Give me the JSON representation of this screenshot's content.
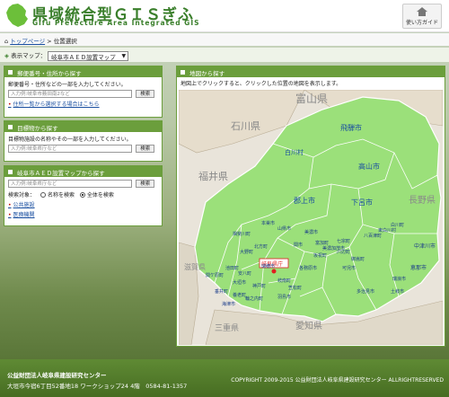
{
  "header": {
    "title": "県域統合型ＧＩＳぎふ",
    "subtitle": "Gifu Prefecture Area Integrated GIS",
    "guide_label": "使い方ガイド"
  },
  "breadcrumb": {
    "home": "トップページ",
    "separator": ">",
    "current": "位置選択"
  },
  "display_map": {
    "label": "表示マップ：",
    "selected": "岐阜市ＡＥＤ設置マップ"
  },
  "postal_panel": {
    "title": "郵便番号・住所から探す",
    "instruction": "郵便番号・住所などの一部を入力してください。",
    "placeholder": "入力例:岐阜市薮田南2など",
    "search_label": "検索",
    "link_label": "住所一覧から選択する場合はこちら"
  },
  "landmark_panel": {
    "title": "目標物から探す",
    "instruction": "目標物施設の名称やその一部を入力してください。",
    "placeholder": "入力例:岐阜県庁など",
    "search_label": "検索"
  },
  "aed_panel": {
    "title": "岐阜市ＡＥＤ設置マップから探す",
    "placeholder": "入力例:岐阜県庁など",
    "search_label": "検索",
    "target_label": "検索対象：",
    "option_name": "名称を検索",
    "option_all": "全体を検索",
    "links": [
      "公共施設",
      "医療機関"
    ]
  },
  "map_panel": {
    "title": "地図から探す",
    "description": "地図上でクリックすると、クリックした位置の地図を表示します。",
    "regions": {
      "outside": [
        "富山県",
        "石川県",
        "福井県",
        "長野県",
        "滋賀県",
        "三重県",
        "愛知県"
      ],
      "north": [
        "飛騨市",
        "白川村",
        "高山市",
        "郡上市",
        "下呂市"
      ],
      "central": [
        "中津川市",
        "恵那市",
        "白川町",
        "東白川村",
        "八百津町",
        "瑞浪市",
        "土岐市",
        "多治見市",
        "可児市",
        "美濃加茂市",
        "七宗町",
        "川辺町",
        "御嵩町",
        "富加町",
        "坂祝町",
        "関市",
        "美濃市",
        "山県市",
        "本巣市",
        "揖斐川町",
        "大野町",
        "池田町",
        "北方町",
        "瑞穂市",
        "大垣市",
        "神戸町",
        "垂井町",
        "関ケ原町",
        "養老町",
        "輪之内町",
        "安八町",
        "海津市",
        "羽島市",
        "岐南町",
        "笠松町",
        "各務原市"
      ],
      "highlight": "岐阜県庁"
    }
  },
  "footer": {
    "org": "公益財団法人岐阜県建設研究センター",
    "address": "大垣市今宿6丁目52番地18 ワークショップ24 4階　0584-81-1357",
    "copyright": "COPYRIGHT 2009-2015 公益財団法人岐阜県建設研究センター ALLRIGHTRESERVED"
  },
  "colors": {
    "brand_green": "#3a7f2b",
    "panel_green": "#6b9e3c",
    "map_land": "#9be07a",
    "highlight_red": "#e02020"
  }
}
